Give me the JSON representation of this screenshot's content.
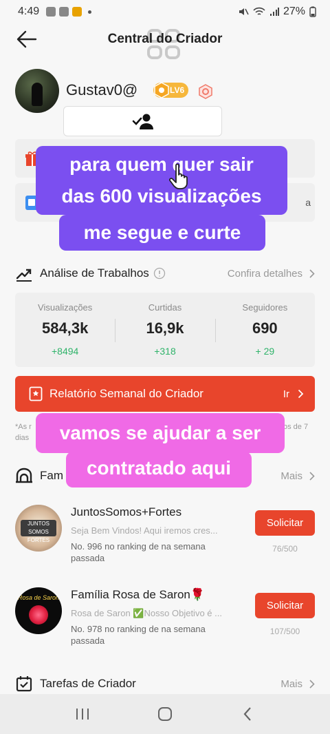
{
  "status_bar": {
    "time": "4:49",
    "battery": "27%"
  },
  "header": {
    "title": "Central do Criador"
  },
  "profile": {
    "username": "Gustav0@",
    "level": "LV6"
  },
  "rows": {
    "row2_cut_text": "a"
  },
  "captions": {
    "line1": "para quem quer sair",
    "line2": "das 600 visualizações",
    "line3": "me segue e curte",
    "line4": "vamos se ajudar a ser",
    "line5": "contratado aqui"
  },
  "analysis": {
    "title": "Análise de Trabalhos",
    "details_link": "Confira detalhes",
    "stats": [
      {
        "label": "Visualizações",
        "value": "584,3k",
        "delta": "+8494"
      },
      {
        "label": "Curtidas",
        "value": "16,9k",
        "delta": "+318"
      },
      {
        "label": "Seguidores",
        "value": "690",
        "delta": "+ 29"
      }
    ]
  },
  "report": {
    "label": "Relatório Semanal do Criador",
    "go": "Ir"
  },
  "note": {
    "left_line1": "*As r",
    "left_line2": "dias",
    "right": "os de 7"
  },
  "families": {
    "title": "Fam",
    "more": "Mais",
    "items": [
      {
        "name": "JuntosSomos+Fortes",
        "description": "Seja Bem Vindos! Aqui iremos cres...",
        "rank_line1": "No. 996 no ranking de na semana",
        "rank_line2": "passada",
        "button": "Solicitar",
        "count": "76/500",
        "avatar_text": "JUNTOS SOMOS FORTES"
      },
      {
        "name": "Família Rosa de Saron🌹",
        "description": "Rosa de Saron ✅Nosso Objetivo é ...",
        "rank_line1": "No. 978 no ranking de na semana",
        "rank_line2": "passada",
        "button": "Solicitar",
        "count": "107/500",
        "avatar_text": "Rosa de Saron"
      }
    ]
  },
  "tasks": {
    "title": "Tarefas de Criador",
    "more": "Mais"
  },
  "colors": {
    "accent_red": "#e8452c",
    "caption_purple": "#7b4ff0",
    "caption_pink": "#f06ae6",
    "delta_green": "#2fb36a"
  },
  "icons": [
    "back-arrow-icon",
    "gift-icon",
    "document-icon",
    "trend-chart-icon",
    "info-icon",
    "chevron-right-icon",
    "home-icon",
    "calendar-check-icon",
    "recent-apps-icon",
    "home-nav-icon",
    "back-nav-icon",
    "follow-user-icon",
    "hand-pointer-icon"
  ]
}
